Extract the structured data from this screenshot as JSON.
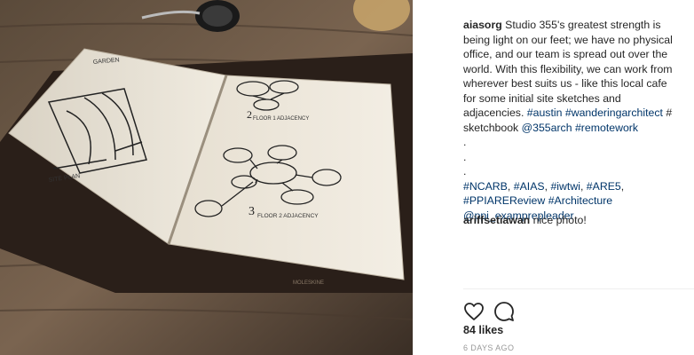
{
  "post": {
    "username": "aiasorg",
    "caption_lines": [
      "Studio 355's greatest strength is",
      "being light on our feet; we have no physical",
      "office, and our team is spread out over the",
      "world. With this flexibility, we can work from",
      "wherever best suits us - like this local cafe",
      "for some initial site sketches and"
    ],
    "caption_line7_text": "adjacencies. ",
    "tag_austin": "#austin",
    "tag_wandering": "#wanderingarchitect",
    "caption_line7_hash": " #",
    "caption_line8_text": "sketchbook ",
    "mention_355arch": "@355arch",
    "tag_remotework": "#remotework",
    "dots": [
      ".",
      ".",
      "."
    ],
    "hashtags_line1": [
      {
        "text": "#NCARB"
      },
      {
        "text": "#AIAS"
      },
      {
        "text": "#iwtwi"
      },
      {
        "text": "#ARE5"
      }
    ],
    "tag_ppiare": "#PPIAREReview",
    "tag_architecture": "#Architecture",
    "mention_ppi": "@ppi_examprepleader"
  },
  "comment": {
    "username": "ariffsetiawan",
    "text": "nice photo!"
  },
  "actions": {
    "like_icon": "heart-icon",
    "comment_icon": "speech-bubble-icon"
  },
  "likes": "84 likes",
  "timestamp": "6 DAYS AGO",
  "sketch_labels": {
    "site_plan": "SITE PLAN",
    "floor1": "FLOOR 1 ADJACENCY",
    "floor2": "FLOOR 2 ADJACENCY",
    "cover_text": "MOLESKINE"
  },
  "colors": {
    "link": "#003569",
    "text": "#262626",
    "muted": "#999999"
  }
}
